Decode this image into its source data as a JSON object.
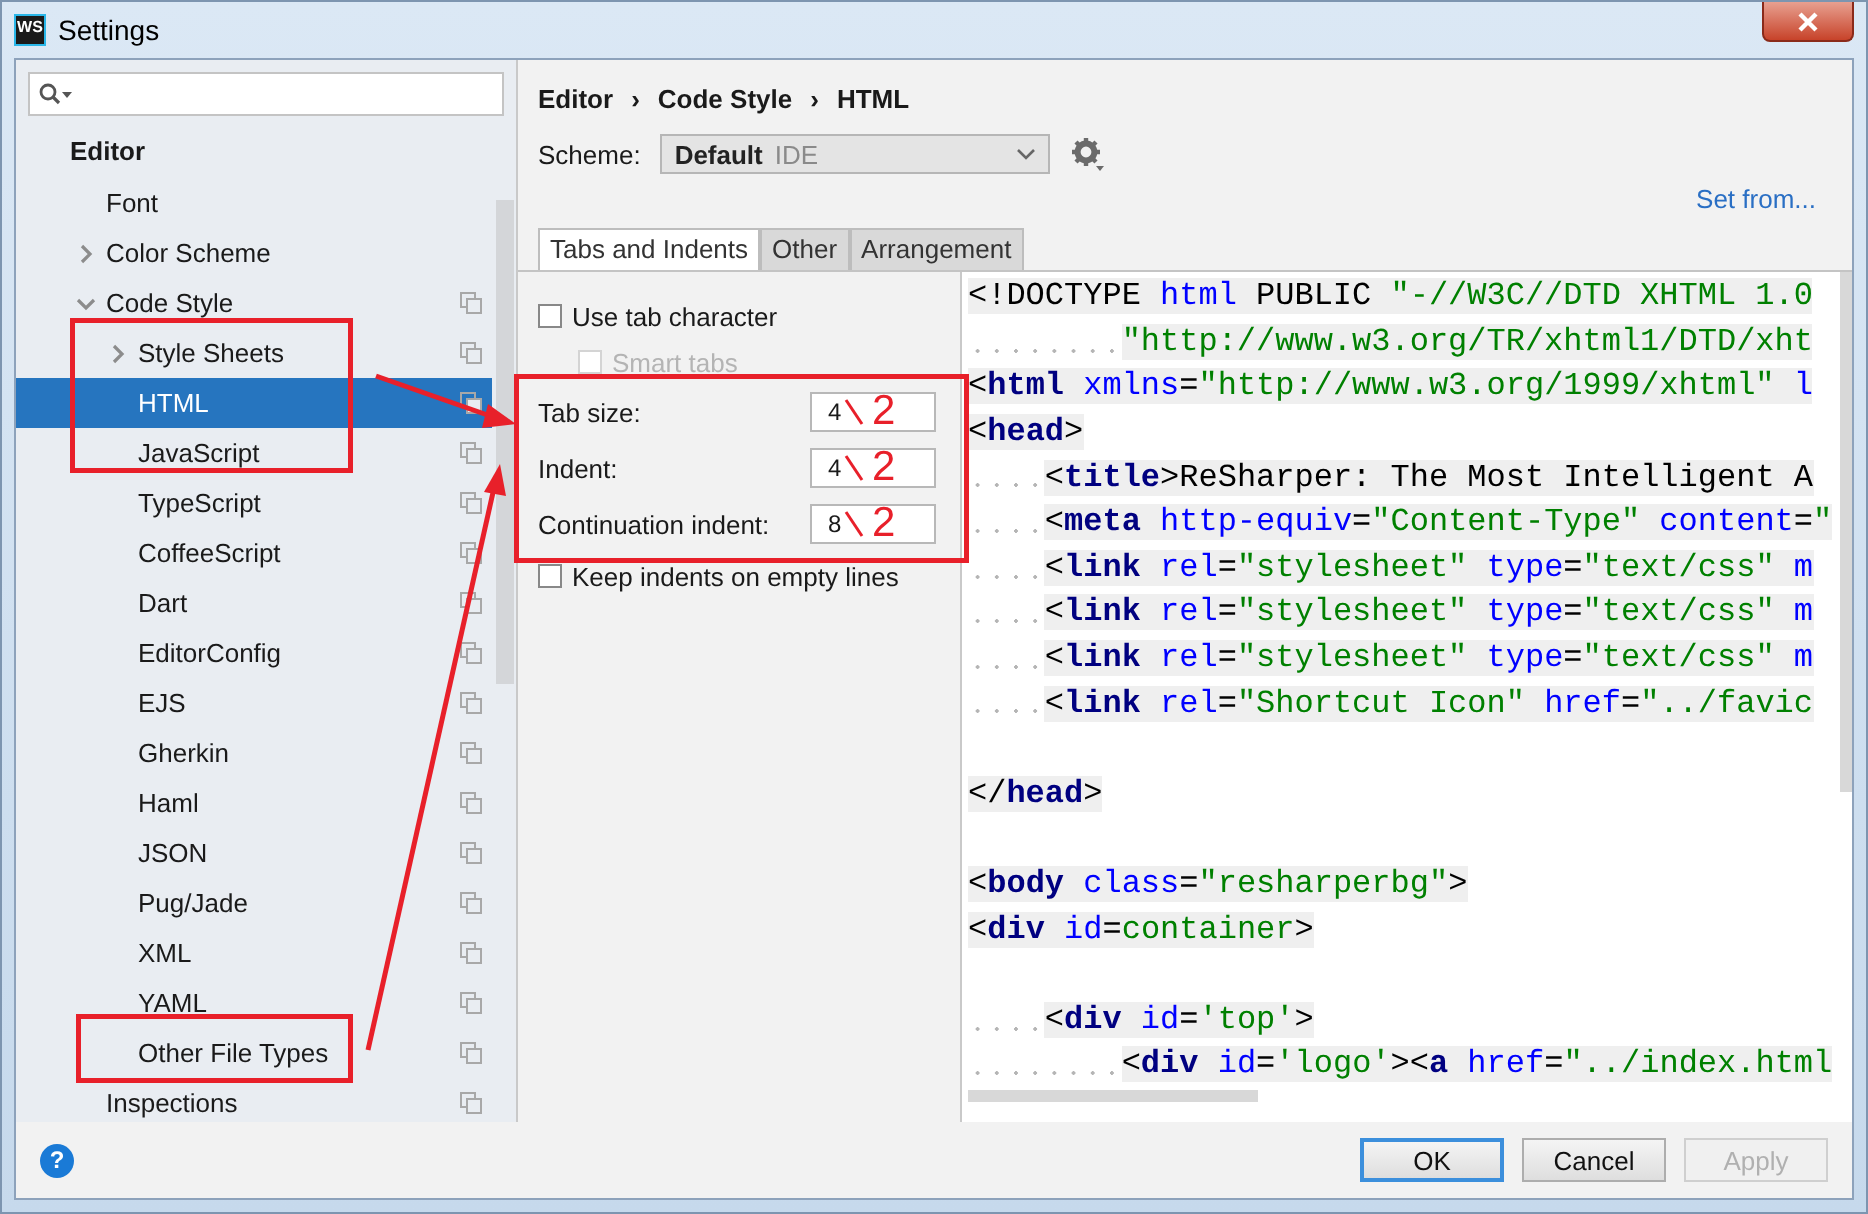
{
  "window": {
    "app_icon": "WS",
    "title": "Settings"
  },
  "sidebar": {
    "items": [
      {
        "label": "Editor",
        "children": [
          {
            "label": "Font",
            "scheme_icon": false,
            "selected": false
          },
          {
            "label": "Color Scheme",
            "expanded": false,
            "scheme_icon": false,
            "selected": false
          },
          {
            "label": "Code Style",
            "expanded": true,
            "scheme_icon": true,
            "selected": false,
            "children": [
              {
                "label": "Style Sheets",
                "expanded": false,
                "scheme_icon": true,
                "selected": false
              },
              {
                "label": "HTML",
                "scheme_icon": true,
                "selected": true
              },
              {
                "label": "JavaScript",
                "scheme_icon": true,
                "selected": false
              },
              {
                "label": "TypeScript",
                "scheme_icon": true,
                "selected": false
              },
              {
                "label": "CoffeeScript",
                "scheme_icon": true,
                "selected": false
              },
              {
                "label": "Dart",
                "scheme_icon": true,
                "selected": false
              },
              {
                "label": "EditorConfig",
                "scheme_icon": true,
                "selected": false
              },
              {
                "label": "EJS",
                "scheme_icon": true,
                "selected": false
              },
              {
                "label": "Gherkin",
                "scheme_icon": true,
                "selected": false
              },
              {
                "label": "Haml",
                "scheme_icon": true,
                "selected": false
              },
              {
                "label": "JSON",
                "scheme_icon": true,
                "selected": false
              },
              {
                "label": "Pug/Jade",
                "scheme_icon": true,
                "selected": false
              },
              {
                "label": "XML",
                "scheme_icon": true,
                "selected": false
              },
              {
                "label": "YAML",
                "scheme_icon": true,
                "selected": false
              },
              {
                "label": "Other File Types",
                "scheme_icon": true,
                "selected": false
              }
            ]
          },
          {
            "label": "Inspections",
            "scheme_icon": true,
            "selected": false
          }
        ]
      }
    ]
  },
  "breadcrumb": {
    "separator": "›",
    "items": [
      "Editor",
      "Code Style",
      "HTML"
    ]
  },
  "scheme": {
    "label": "Scheme:",
    "value": "Default",
    "tag": "IDE",
    "set_from": "Set from..."
  },
  "tabs": [
    {
      "label": "Tabs and Indents",
      "selected": true
    },
    {
      "label": "Other",
      "selected": false
    },
    {
      "label": "Arrangement",
      "selected": false
    }
  ],
  "options": [
    {
      "kind": "checkbox",
      "label": "Use tab character",
      "checked": false,
      "disabled": false
    },
    {
      "kind": "checkbox",
      "label": "Smart tabs",
      "checked": false,
      "disabled": true
    },
    {
      "kind": "number",
      "label": "Tab size:",
      "value": "4",
      "annotation": "2"
    },
    {
      "kind": "number",
      "label": "Indent:",
      "value": "4",
      "annotation": "2"
    },
    {
      "kind": "number",
      "label": "Continuation indent:",
      "value": "8",
      "annotation": "2"
    },
    {
      "kind": "checkbox",
      "label": "Keep indents on empty lines",
      "checked": false,
      "disabled": false
    }
  ],
  "code_lines": [
    {
      "kind": "code",
      "tokens": [
        {
          "kind": "punct",
          "text": "<!DOCTYPE "
        },
        {
          "kind": "attr",
          "text": "html"
        },
        {
          "kind": "punct",
          "text": " PUBLIC "
        },
        {
          "kind": "string",
          "text": "\"-//W3C//DTD XHTML 1.0"
        }
      ]
    },
    {
      "kind": "nested",
      "tokens": [
        {
          "kind": "string",
          "text": "\"http://www.w3.org/TR/xhtml1/DTD/xht"
        }
      ]
    },
    {
      "kind": "code",
      "tokens": [
        {
          "kind": "punct",
          "text": "<"
        },
        {
          "kind": "tag",
          "text": "html"
        },
        {
          "kind": "attr",
          "text": " xmlns"
        },
        {
          "kind": "punct",
          "text": "="
        },
        {
          "kind": "string",
          "text": "\"http://www.w3.org/1999/xhtml\""
        },
        {
          "kind": "attr",
          "text": " l"
        }
      ]
    },
    {
      "kind": "code",
      "tokens": [
        {
          "kind": "punct",
          "text": "<"
        },
        {
          "kind": "tag",
          "text": "head"
        },
        {
          "kind": "punct",
          "text": ">"
        }
      ]
    },
    {
      "kind": "indented",
      "tokens": [
        {
          "kind": "punct",
          "text": "<"
        },
        {
          "kind": "tag",
          "text": "title"
        },
        {
          "kind": "punct",
          "text": ">"
        },
        {
          "kind": "text",
          "text": "ReSharper: The Most Intelligent A"
        }
      ]
    },
    {
      "kind": "indented",
      "tokens": [
        {
          "kind": "punct",
          "text": "<"
        },
        {
          "kind": "tag",
          "text": "meta"
        },
        {
          "kind": "attr",
          "text": " http-equiv"
        },
        {
          "kind": "punct",
          "text": "="
        },
        {
          "kind": "string",
          "text": "\"Content-Type\""
        },
        {
          "kind": "attr",
          "text": " content"
        },
        {
          "kind": "punct",
          "text": "="
        },
        {
          "kind": "string",
          "text": "\""
        }
      ]
    },
    {
      "kind": "indented",
      "tokens": [
        {
          "kind": "punct",
          "text": "<"
        },
        {
          "kind": "tag",
          "text": "link"
        },
        {
          "kind": "attr",
          "text": " rel"
        },
        {
          "kind": "punct",
          "text": "="
        },
        {
          "kind": "string",
          "text": "\"stylesheet\""
        },
        {
          "kind": "attr",
          "text": " type"
        },
        {
          "kind": "punct",
          "text": "="
        },
        {
          "kind": "string",
          "text": "\"text/css\""
        },
        {
          "kind": "attr",
          "text": " m"
        }
      ]
    },
    {
      "kind": "indented",
      "tokens": [
        {
          "kind": "punct",
          "text": "<"
        },
        {
          "kind": "tag",
          "text": "link"
        },
        {
          "kind": "attr",
          "text": " rel"
        },
        {
          "kind": "punct",
          "text": "="
        },
        {
          "kind": "string",
          "text": "\"stylesheet\""
        },
        {
          "kind": "attr",
          "text": " type"
        },
        {
          "kind": "punct",
          "text": "="
        },
        {
          "kind": "string",
          "text": "\"text/css\""
        },
        {
          "kind": "attr",
          "text": " m"
        }
      ]
    },
    {
      "kind": "indented",
      "tokens": [
        {
          "kind": "punct",
          "text": "<"
        },
        {
          "kind": "tag",
          "text": "link"
        },
        {
          "kind": "attr",
          "text": " rel"
        },
        {
          "kind": "punct",
          "text": "="
        },
        {
          "kind": "string",
          "text": "\"stylesheet\""
        },
        {
          "kind": "attr",
          "text": " type"
        },
        {
          "kind": "punct",
          "text": "="
        },
        {
          "kind": "string",
          "text": "\"text/css\""
        },
        {
          "kind": "attr",
          "text": " m"
        }
      ]
    },
    {
      "kind": "indented",
      "tokens": [
        {
          "kind": "punct",
          "text": "<"
        },
        {
          "kind": "tag",
          "text": "link"
        },
        {
          "kind": "attr",
          "text": " rel"
        },
        {
          "kind": "punct",
          "text": "="
        },
        {
          "kind": "string",
          "text": "\"Shortcut Icon\""
        },
        {
          "kind": "attr",
          "text": " href"
        },
        {
          "kind": "punct",
          "text": "="
        },
        {
          "kind": "string",
          "text": "\"../favic"
        }
      ]
    },
    {
      "kind": "blank"
    },
    {
      "kind": "code",
      "tokens": [
        {
          "kind": "punct",
          "text": "</"
        },
        {
          "kind": "tag",
          "text": "head"
        },
        {
          "kind": "punct",
          "text": ">"
        }
      ]
    },
    {
      "kind": "blank"
    },
    {
      "kind": "code",
      "tokens": [
        {
          "kind": "punct",
          "text": "<"
        },
        {
          "kind": "tag",
          "text": "body"
        },
        {
          "kind": "attr",
          "text": " class"
        },
        {
          "kind": "punct",
          "text": "="
        },
        {
          "kind": "string",
          "text": "\"resharperbg\""
        },
        {
          "kind": "punct",
          "text": ">"
        }
      ]
    },
    {
      "kind": "code",
      "tokens": [
        {
          "kind": "punct",
          "text": "<"
        },
        {
          "kind": "tag",
          "text": "div"
        },
        {
          "kind": "attr",
          "text": " id"
        },
        {
          "kind": "punct",
          "text": "="
        },
        {
          "kind": "string",
          "text": "container"
        },
        {
          "kind": "punct",
          "text": ">"
        }
      ]
    },
    {
      "kind": "blank"
    },
    {
      "kind": "indented",
      "tokens": [
        {
          "kind": "punct",
          "text": "<"
        },
        {
          "kind": "tag",
          "text": "div"
        },
        {
          "kind": "attr",
          "text": " id"
        },
        {
          "kind": "punct",
          "text": "="
        },
        {
          "kind": "string",
          "text": "'top'"
        },
        {
          "kind": "punct",
          "text": ">"
        }
      ]
    },
    {
      "kind": "nested",
      "tokens": [
        {
          "kind": "punct",
          "text": "<"
        },
        {
          "kind": "tag",
          "text": "div"
        },
        {
          "kind": "attr",
          "text": " id"
        },
        {
          "kind": "punct",
          "text": "="
        },
        {
          "kind": "string",
          "text": "'logo'"
        },
        {
          "kind": "punct",
          "text": "><"
        },
        {
          "kind": "tag",
          "text": "a"
        },
        {
          "kind": "attr",
          "text": " href"
        },
        {
          "kind": "punct",
          "text": "="
        },
        {
          "kind": "string",
          "text": "\"../index.html"
        }
      ]
    }
  ],
  "footer": {
    "help": "?",
    "buttons": [
      {
        "label": "OK",
        "kind": "default",
        "disabled": false
      },
      {
        "label": "Cancel",
        "kind": "normal",
        "disabled": false
      },
      {
        "label": "Apply",
        "kind": "normal",
        "disabled": true
      }
    ]
  }
}
